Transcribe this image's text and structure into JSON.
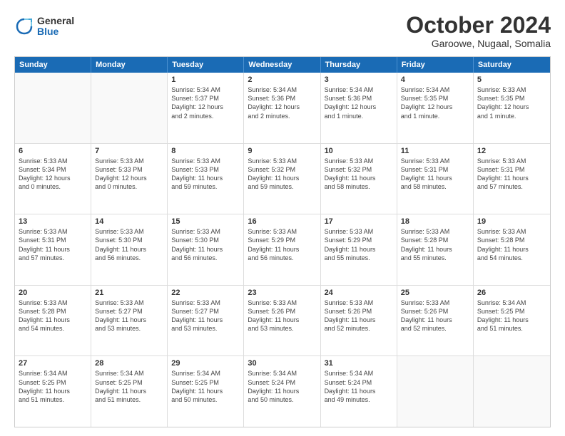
{
  "logo": {
    "general": "General",
    "blue": "Blue"
  },
  "title": "October 2024",
  "subtitle": "Garoowe, Nugaal, Somalia",
  "header": {
    "days": [
      "Sunday",
      "Monday",
      "Tuesday",
      "Wednesday",
      "Thursday",
      "Friday",
      "Saturday"
    ]
  },
  "rows": [
    [
      {
        "day": "",
        "lines": []
      },
      {
        "day": "",
        "lines": []
      },
      {
        "day": "1",
        "lines": [
          "Sunrise: 5:34 AM",
          "Sunset: 5:37 PM",
          "Daylight: 12 hours",
          "and 2 minutes."
        ]
      },
      {
        "day": "2",
        "lines": [
          "Sunrise: 5:34 AM",
          "Sunset: 5:36 PM",
          "Daylight: 12 hours",
          "and 2 minutes."
        ]
      },
      {
        "day": "3",
        "lines": [
          "Sunrise: 5:34 AM",
          "Sunset: 5:36 PM",
          "Daylight: 12 hours",
          "and 1 minute."
        ]
      },
      {
        "day": "4",
        "lines": [
          "Sunrise: 5:34 AM",
          "Sunset: 5:35 PM",
          "Daylight: 12 hours",
          "and 1 minute."
        ]
      },
      {
        "day": "5",
        "lines": [
          "Sunrise: 5:33 AM",
          "Sunset: 5:35 PM",
          "Daylight: 12 hours",
          "and 1 minute."
        ]
      }
    ],
    [
      {
        "day": "6",
        "lines": [
          "Sunrise: 5:33 AM",
          "Sunset: 5:34 PM",
          "Daylight: 12 hours",
          "and 0 minutes."
        ]
      },
      {
        "day": "7",
        "lines": [
          "Sunrise: 5:33 AM",
          "Sunset: 5:33 PM",
          "Daylight: 12 hours",
          "and 0 minutes."
        ]
      },
      {
        "day": "8",
        "lines": [
          "Sunrise: 5:33 AM",
          "Sunset: 5:33 PM",
          "Daylight: 11 hours",
          "and 59 minutes."
        ]
      },
      {
        "day": "9",
        "lines": [
          "Sunrise: 5:33 AM",
          "Sunset: 5:32 PM",
          "Daylight: 11 hours",
          "and 59 minutes."
        ]
      },
      {
        "day": "10",
        "lines": [
          "Sunrise: 5:33 AM",
          "Sunset: 5:32 PM",
          "Daylight: 11 hours",
          "and 58 minutes."
        ]
      },
      {
        "day": "11",
        "lines": [
          "Sunrise: 5:33 AM",
          "Sunset: 5:31 PM",
          "Daylight: 11 hours",
          "and 58 minutes."
        ]
      },
      {
        "day": "12",
        "lines": [
          "Sunrise: 5:33 AM",
          "Sunset: 5:31 PM",
          "Daylight: 11 hours",
          "and 57 minutes."
        ]
      }
    ],
    [
      {
        "day": "13",
        "lines": [
          "Sunrise: 5:33 AM",
          "Sunset: 5:31 PM",
          "Daylight: 11 hours",
          "and 57 minutes."
        ]
      },
      {
        "day": "14",
        "lines": [
          "Sunrise: 5:33 AM",
          "Sunset: 5:30 PM",
          "Daylight: 11 hours",
          "and 56 minutes."
        ]
      },
      {
        "day": "15",
        "lines": [
          "Sunrise: 5:33 AM",
          "Sunset: 5:30 PM",
          "Daylight: 11 hours",
          "and 56 minutes."
        ]
      },
      {
        "day": "16",
        "lines": [
          "Sunrise: 5:33 AM",
          "Sunset: 5:29 PM",
          "Daylight: 11 hours",
          "and 56 minutes."
        ]
      },
      {
        "day": "17",
        "lines": [
          "Sunrise: 5:33 AM",
          "Sunset: 5:29 PM",
          "Daylight: 11 hours",
          "and 55 minutes."
        ]
      },
      {
        "day": "18",
        "lines": [
          "Sunrise: 5:33 AM",
          "Sunset: 5:28 PM",
          "Daylight: 11 hours",
          "and 55 minutes."
        ]
      },
      {
        "day": "19",
        "lines": [
          "Sunrise: 5:33 AM",
          "Sunset: 5:28 PM",
          "Daylight: 11 hours",
          "and 54 minutes."
        ]
      }
    ],
    [
      {
        "day": "20",
        "lines": [
          "Sunrise: 5:33 AM",
          "Sunset: 5:28 PM",
          "Daylight: 11 hours",
          "and 54 minutes."
        ]
      },
      {
        "day": "21",
        "lines": [
          "Sunrise: 5:33 AM",
          "Sunset: 5:27 PM",
          "Daylight: 11 hours",
          "and 53 minutes."
        ]
      },
      {
        "day": "22",
        "lines": [
          "Sunrise: 5:33 AM",
          "Sunset: 5:27 PM",
          "Daylight: 11 hours",
          "and 53 minutes."
        ]
      },
      {
        "day": "23",
        "lines": [
          "Sunrise: 5:33 AM",
          "Sunset: 5:26 PM",
          "Daylight: 11 hours",
          "and 53 minutes."
        ]
      },
      {
        "day": "24",
        "lines": [
          "Sunrise: 5:33 AM",
          "Sunset: 5:26 PM",
          "Daylight: 11 hours",
          "and 52 minutes."
        ]
      },
      {
        "day": "25",
        "lines": [
          "Sunrise: 5:33 AM",
          "Sunset: 5:26 PM",
          "Daylight: 11 hours",
          "and 52 minutes."
        ]
      },
      {
        "day": "26",
        "lines": [
          "Sunrise: 5:34 AM",
          "Sunset: 5:25 PM",
          "Daylight: 11 hours",
          "and 51 minutes."
        ]
      }
    ],
    [
      {
        "day": "27",
        "lines": [
          "Sunrise: 5:34 AM",
          "Sunset: 5:25 PM",
          "Daylight: 11 hours",
          "and 51 minutes."
        ]
      },
      {
        "day": "28",
        "lines": [
          "Sunrise: 5:34 AM",
          "Sunset: 5:25 PM",
          "Daylight: 11 hours",
          "and 51 minutes."
        ]
      },
      {
        "day": "29",
        "lines": [
          "Sunrise: 5:34 AM",
          "Sunset: 5:25 PM",
          "Daylight: 11 hours",
          "and 50 minutes."
        ]
      },
      {
        "day": "30",
        "lines": [
          "Sunrise: 5:34 AM",
          "Sunset: 5:24 PM",
          "Daylight: 11 hours",
          "and 50 minutes."
        ]
      },
      {
        "day": "31",
        "lines": [
          "Sunrise: 5:34 AM",
          "Sunset: 5:24 PM",
          "Daylight: 11 hours",
          "and 49 minutes."
        ]
      },
      {
        "day": "",
        "lines": []
      },
      {
        "day": "",
        "lines": []
      }
    ]
  ]
}
